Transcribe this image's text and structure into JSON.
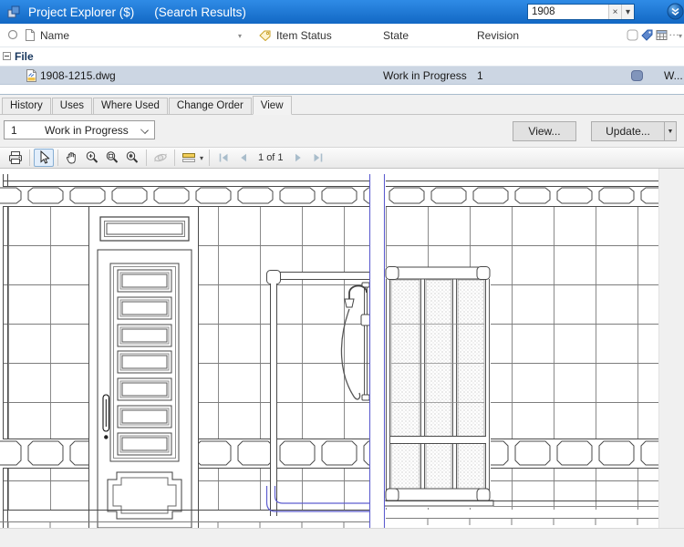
{
  "window": {
    "title": "Project Explorer ($)",
    "subtitle": "(Search Results)"
  },
  "search": {
    "value": "1908",
    "clear": "×",
    "dropdown": "▾"
  },
  "list": {
    "columns": {
      "name": "Name",
      "item_status": "Item Status",
      "state": "State",
      "revision": "Revision",
      "filter_glyph": "▾",
      "overflow": "…"
    },
    "group": {
      "label": "File"
    },
    "row": {
      "name": "1908-1215.dwg",
      "state": "Work in Progress",
      "revision": "1",
      "trailing": "W..."
    }
  },
  "tabs": [
    {
      "label": "History"
    },
    {
      "label": "Uses"
    },
    {
      "label": "Where Used"
    },
    {
      "label": "Change Order"
    },
    {
      "label": "View"
    }
  ],
  "revision_selector": {
    "number": "1",
    "state": "Work in Progress"
  },
  "actions": {
    "view": "View...",
    "update": "Update...",
    "update_dropdown": "▼"
  },
  "viewer_toolbar": {
    "page_indicator": "1 of 1",
    "layers_dropdown": "▾"
  },
  "colors": {
    "titlebar": "#1a77d4",
    "selection": "#ccd6e3",
    "cad_line": "#4a4a4a",
    "cad_grid": "#7d7d7d",
    "cad_blue": "#5d5dcf"
  }
}
